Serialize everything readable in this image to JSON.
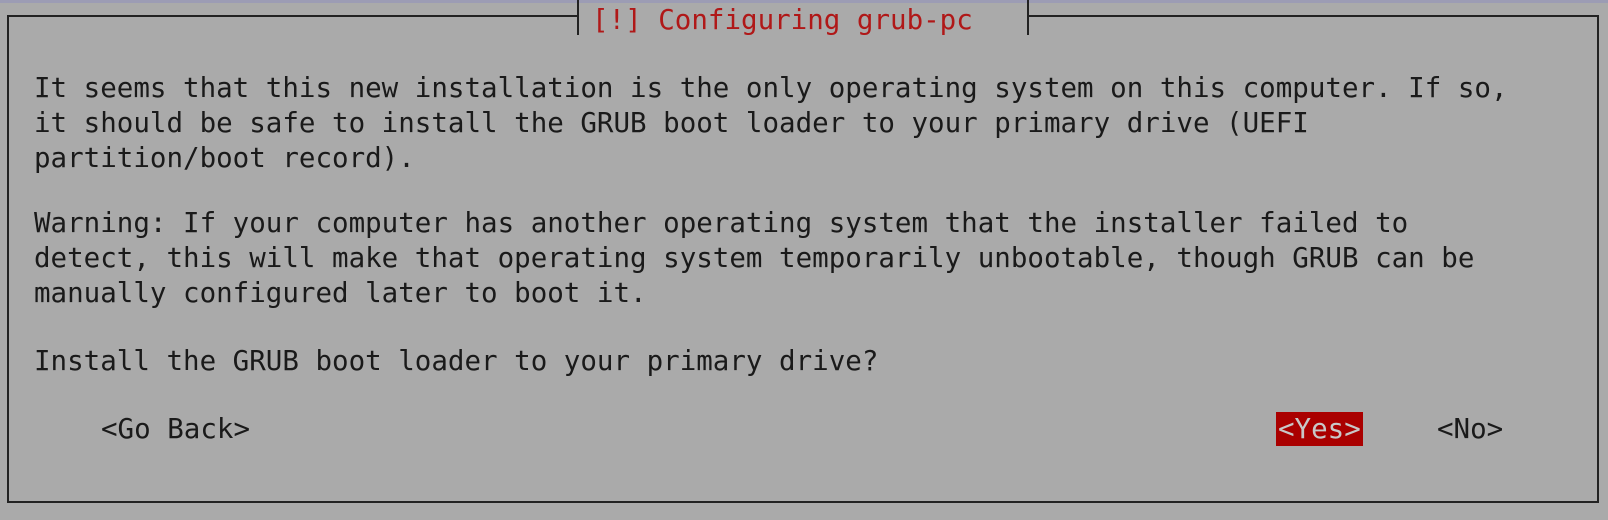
{
  "dialog": {
    "title": "[!] Configuring grub-pc",
    "paragraphs": [
      "It seems that this new installation is the only operating system on this computer. If so,",
      "it should be safe to install the GRUB boot loader to your primary drive (UEFI",
      "partition/boot record).",
      "Warning: If your computer has another operating system that the installer failed to",
      "detect, this will make that operating system temporarily unbootable, though GRUB can be",
      "manually configured later to boot it.",
      "Install the GRUB boot loader to your primary drive?"
    ],
    "buttons": {
      "go_back": "<Go Back>",
      "yes": "<Yes>",
      "no": "<No>"
    },
    "selected_button": "yes"
  },
  "colors": {
    "background": "#aaaaaa",
    "title": "#b01818",
    "selected": "#aa0000"
  }
}
